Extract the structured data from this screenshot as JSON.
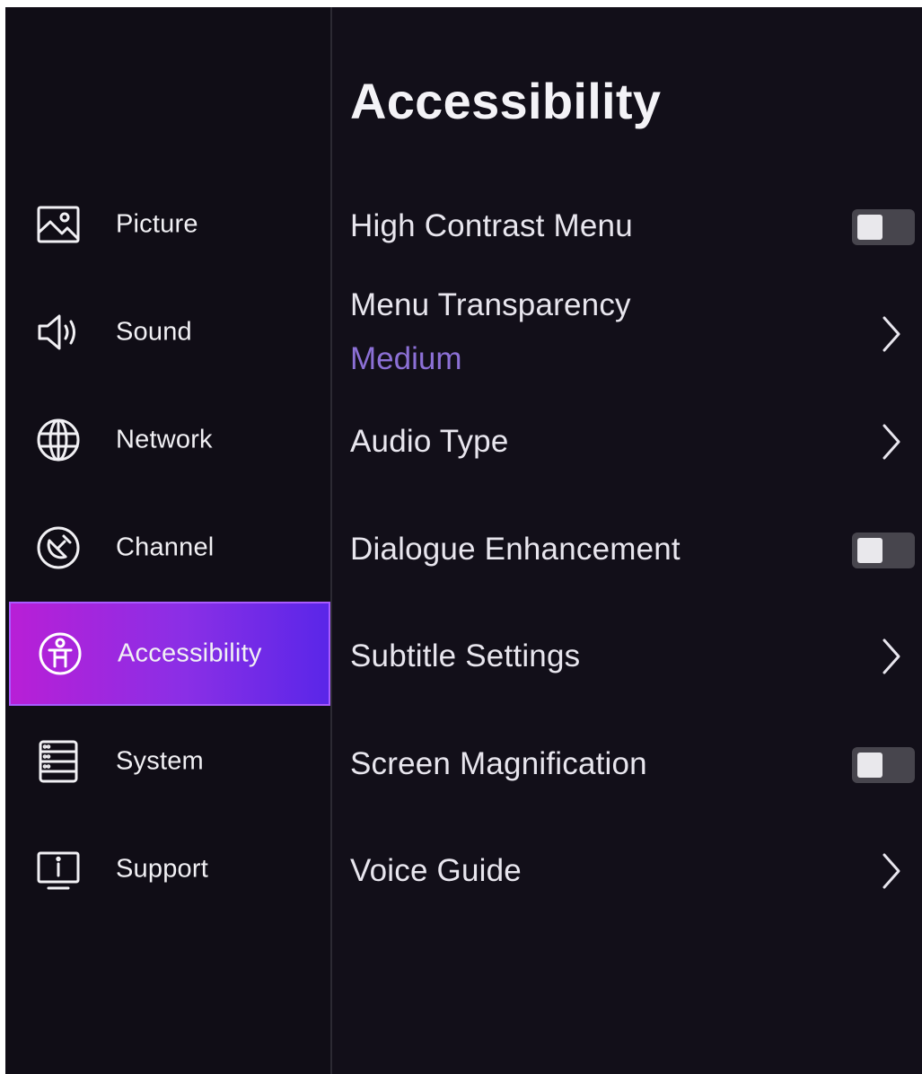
{
  "sidebar": {
    "items": [
      {
        "label": "Picture",
        "icon": "picture-icon",
        "active": false
      },
      {
        "label": "Sound",
        "icon": "speaker-icon",
        "active": false
      },
      {
        "label": "Network",
        "icon": "globe-icon",
        "active": false
      },
      {
        "label": "Channel",
        "icon": "channel-icon",
        "active": false
      },
      {
        "label": "Accessibility",
        "icon": "accessibility-icon",
        "active": true
      },
      {
        "label": "System",
        "icon": "system-icon",
        "active": false
      },
      {
        "label": "Support",
        "icon": "support-icon",
        "active": false
      }
    ]
  },
  "main": {
    "title": "Accessibility",
    "settings": [
      {
        "label": "High Contrast Menu",
        "control": "toggle",
        "state": "off"
      },
      {
        "label": "Menu Transparency",
        "value": "Medium",
        "control": "chevron"
      },
      {
        "label": "Audio Type",
        "control": "chevron"
      },
      {
        "label": "Dialogue Enhancement",
        "control": "toggle",
        "state": "off"
      },
      {
        "label": "Subtitle Settings",
        "control": "chevron"
      },
      {
        "label": "Screen Magnification",
        "control": "toggle",
        "state": "off"
      },
      {
        "label": "Voice Guide",
        "control": "chevron"
      }
    ]
  },
  "colors": {
    "background": "#120f19",
    "active_gradient_start": "#b81fd6",
    "active_gradient_end": "#5a26e8",
    "value_text": "#8c70d6",
    "toggle_off": "#47454d"
  }
}
